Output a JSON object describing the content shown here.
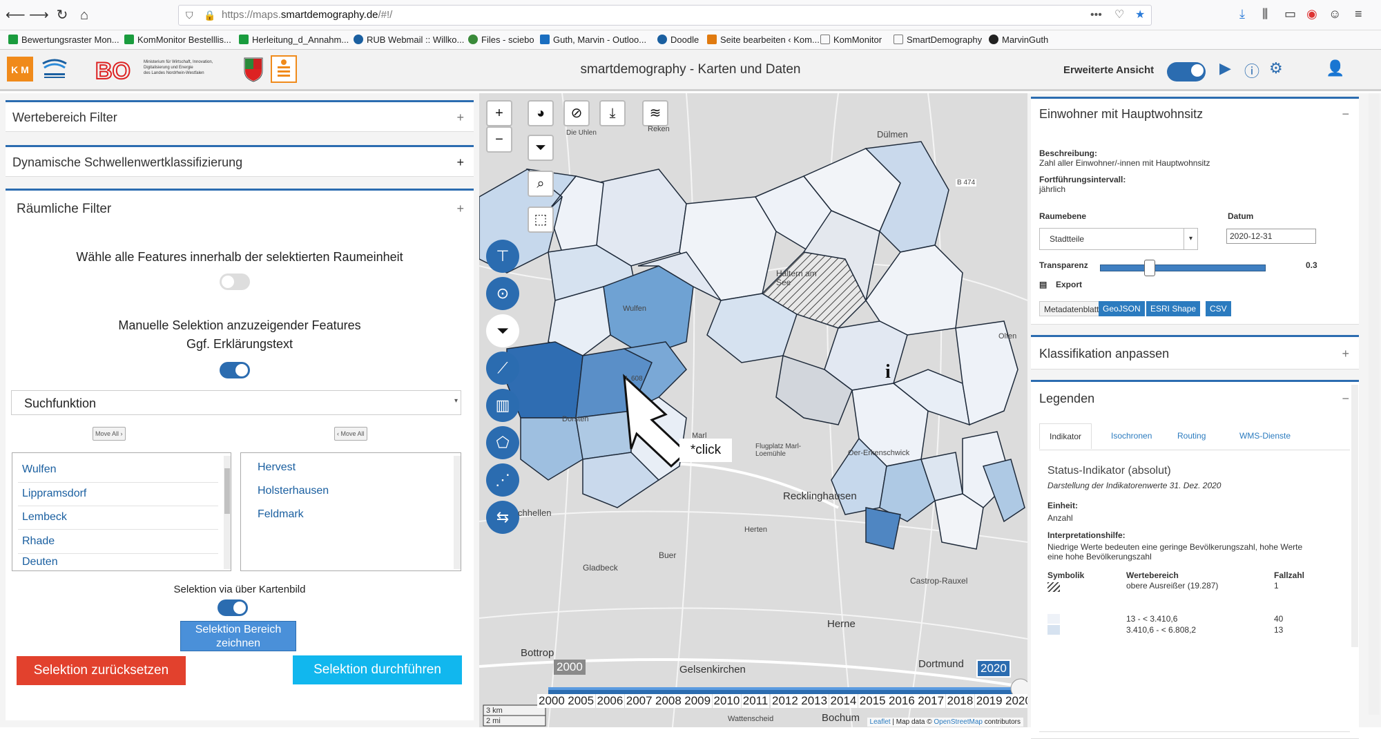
{
  "browser": {
    "url_prefix": "https://maps.",
    "url_host": "smartdemography.de",
    "url_suffix": "/#!/",
    "more": "•••",
    "bookmarks": [
      {
        "label": "Bewertungsraster Mon...",
        "color": "#1a9c3e"
      },
      {
        "label": "KomMonitor Bestelllis...",
        "color": "#1a9c3e"
      },
      {
        "label": "Herleitung_d_Annahm...",
        "color": "#1a9c3e"
      },
      {
        "label": "RUB Webmail :: Willko...",
        "color": "#1a5fa0"
      },
      {
        "label": "Files - sciebo",
        "color": "#3a8a3a"
      },
      {
        "label": "Guth, Marvin - Outloo...",
        "color": "#1a6ec0"
      },
      {
        "label": "Doodle",
        "color": "#1a5fa0"
      },
      {
        "label": "Seite bearbeiten ‹ Kom...",
        "color": "#e07a10"
      },
      {
        "label": "KomMonitor",
        "color": "#777777"
      },
      {
        "label": "SmartDemography",
        "color": "#777777"
      },
      {
        "label": "MarvinGuth",
        "color": "#222222"
      }
    ]
  },
  "header": {
    "title": "smartdemography - Karten und Daten",
    "extended_view": "Erweiterte Ansicht",
    "ministry_text": [
      "Ministerium für Wirtschaft, Innovation,",
      "Digitalisierung und Energie",
      "des Landes Nordrhein-Westfalen"
    ]
  },
  "left": {
    "acc1": "Wertebereich Filter",
    "acc2": "Dynamische Schwellenwertklassifizierung",
    "acc3": "Räumliche Filter",
    "text1": "Wähle alle Features innerhalb der selektierten Raumeinheit",
    "text2": "Manuelle Selektion anzuzeigender Features",
    "text3": "Ggf. Erklärungstext",
    "search": "Suchfunktion",
    "move_all_right": "Move All ›",
    "move_all_left": "‹ Move All",
    "list_available": [
      "Wulfen",
      "Lippramsdorf",
      "Lembeck",
      "Rhade",
      "Deuten"
    ],
    "list_selected": [
      "Hervest",
      "Holsterhausen",
      "Feldmark"
    ],
    "map_select": "Selektion via über Kartenbild",
    "draw_btn": [
      "Selektion Bereich",
      "zeichnen"
    ],
    "reset_btn": "Selektion zurücksetzen",
    "execute_btn": "Selektion durchführen"
  },
  "map": {
    "click_label": "*click",
    "places": {
      "dulmen": "Dülmen",
      "reken": "Reken",
      "haltern": "Haltern am See",
      "wulfen": "Wulfen",
      "dorsten": "Dorsten",
      "marl": "Marl",
      "recklinghausen": "Recklinghausen",
      "herten": "Herten",
      "buer": "Buer",
      "gladbeck": "Gladbeck",
      "herne": "Herne",
      "bottrop": "Bottrop",
      "gelsenkirchen": "Gelsenkirchen",
      "castrop": "Castrop-Rauxel",
      "dortmund": "Dortmund",
      "bochum": "Bochum",
      "olfen": "Olfen",
      "wattenscheid": "Wattenscheid",
      "oer": "Oer-Erkenschwick",
      "flugplatz": "Flugplatz Marl-Loemühle",
      "schellen": "chhellen",
      "die_uhlen": "Die Uhlen",
      "b474": "B 474",
      "l608": "L 608"
    },
    "scale_km": "3 km",
    "scale_mi": "2 mi",
    "attribution_leaflet": "Leaflet",
    "attribution_text": " | Map data © ",
    "attribution_osm": "OpenStreetMap",
    "attribution_end": " contributors",
    "timeline": {
      "start": "2000",
      "end": "2020",
      "current_fraction": 1.0,
      "years": [
        "2000",
        "2005",
        "2006",
        "2007",
        "2008",
        "2009",
        "2010",
        "2011",
        "2012",
        "2013",
        "2014",
        "2015",
        "2016",
        "2017",
        "2018",
        "2019",
        "2020"
      ]
    }
  },
  "right": {
    "title": "Einwohner mit Hauptwohnsitz",
    "desc_label": "Beschreibung:",
    "desc": "Zahl aller Einwohner/-innen mit Hauptwohnsitz",
    "interval_label": "Fortführungsintervall:",
    "interval": "jährlich",
    "level_label": "Raumebene",
    "level": "Stadtteile",
    "date_label": "Datum",
    "date": "2020-12-31",
    "transparency_label": "Transparenz",
    "transparency": "0.3",
    "transparency_value": 0.3,
    "export_label": "Export",
    "export_buttons": [
      "Metadatenblatt",
      "GeoJSON",
      "ESRI Shape",
      "CSV"
    ],
    "classification": "Klassifikation anpassen",
    "legends": "Legenden",
    "tabs": [
      "Indikator",
      "Isochronen",
      "Routing",
      "WMS-Dienste"
    ],
    "status_title": "Status-Indikator (absolut)",
    "status_sub": "Darstellung der Indikatorenwerte 31. Dez. 2020",
    "unit_label": "Einheit:",
    "unit": "Anzahl",
    "interp_label": "Interpretationshilfe:",
    "interp": [
      "Niedrige Werte bedeuten eine geringe Bevölkerungszahl, hohe Werte",
      "eine hohe Bevölkerungszahl"
    ],
    "col_symbol": "Symbolik",
    "col_range": "Wertebereich",
    "col_count": "Fallzahl",
    "rows": [
      {
        "range": "obere Ausreißer (19.287)",
        "count": "1"
      },
      {
        "range": "13 - < 3.410,6",
        "count": "40"
      },
      {
        "range": "3.410,6 - < 6.808,2",
        "count": "13"
      }
    ]
  }
}
